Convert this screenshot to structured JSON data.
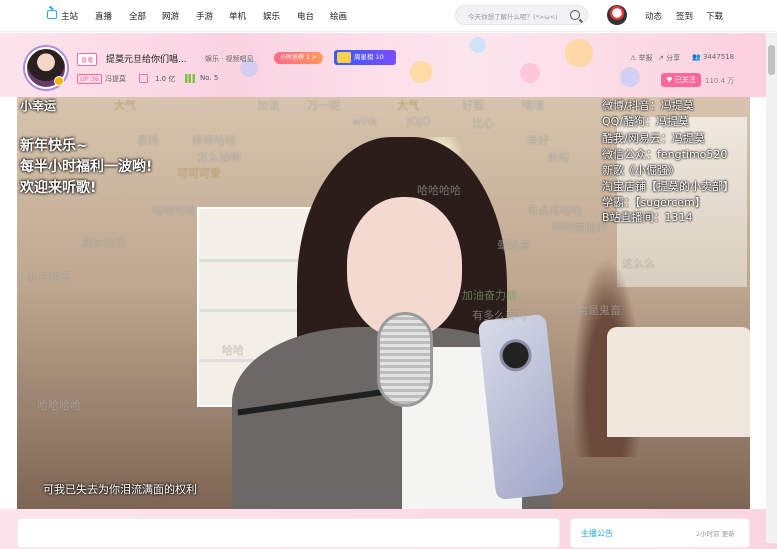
{
  "topnav": {
    "items": [
      "主站",
      "直播",
      "全部",
      "网游",
      "手游",
      "单机",
      "娱乐",
      "电台",
      "绘画"
    ],
    "search_placeholder": "今天你想了解什么呢？(*>ω<)",
    "right": [
      "动态",
      "签到",
      "下载"
    ]
  },
  "room": {
    "live_tag": "直播",
    "title": "提莫元旦给你们唱...",
    "category": "娱乐 · 视频唱见",
    "hour_rank": "小时总榜 1 >",
    "week_rank": "周星榜 10",
    "uid_tag": "UP 36",
    "host_name": "冯提莫",
    "gifts": "1.0 亿",
    "rank": "No. 5",
    "report": "举报",
    "share": "分享",
    "views": "3447518",
    "follow": "已关注",
    "fans": "110.4 万"
  },
  "video": {
    "left_overlay": [
      "小幸运",
      "新年快乐~",
      "每半小时福利一波哟!",
      "欢迎来听歌!"
    ],
    "right_overlay": [
      "微博/抖音：冯提莫",
      "QQ/酷狗：冯提莫",
      "酷我/网易云：冯提莫",
      "微信公众：fengtimo520",
      "新歌《小倔强》",
      "淘宝店铺【提莫的小卖部】",
      "学霸：【sugercem】",
      "B站直播间：1314"
    ],
    "subtitle": "可我已失去为你泪流满面的权利",
    "danmaku": [
      "大气",
      "加油",
      "万一呢",
      "好看",
      "嘿嘿",
      "表扬",
      "棒棒哈哈",
      "哈哈哈哈",
      "哈哈",
      "有点咸哈哈",
      "新年快乐",
      "晕好高",
      "加油奋力给",
      "明明是能的",
      "有多么美吗",
      "窝是鬼畜",
      "这么么",
      "wink",
      "JOJO",
      "比心",
      "美好",
      "夺你",
      "来啦",
      "怎么抽啊",
      "可可可爱"
    ]
  },
  "sidebar": {
    "notice_title": "主播公告",
    "notice_time": "2小时前 更新"
  }
}
